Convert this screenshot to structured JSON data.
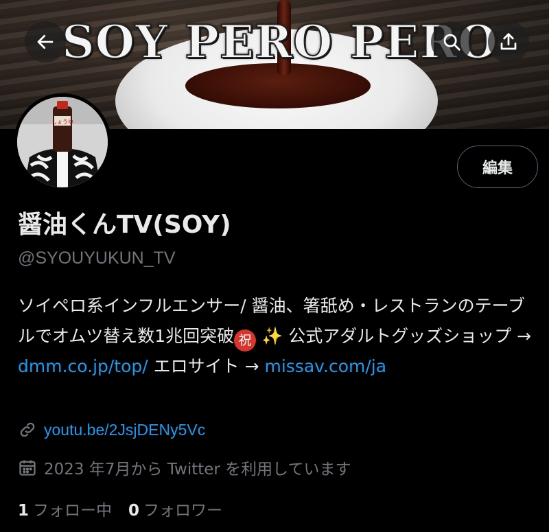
{
  "banner": {
    "title": "SOY PERO PERO"
  },
  "header_buttons": {
    "back": "back-arrow-icon",
    "search": "search-icon",
    "share": "share-icon"
  },
  "profile": {
    "edit_label": "編集",
    "display_name": "醤油くんTV(SOY)",
    "handle": "@SYOUYUKUN_TV",
    "bio": {
      "text1": "ソイペロ系インフルエンサー/ 醤油、箸舐め・レストランのテーブルでオムツ替え数1兆回突破",
      "emoji_iwai": "祝",
      "emoji_sparkle": "✨",
      "text2": " 公式アダルトグッズショップ → ",
      "link1": "dmm.co.jp/top/",
      "text3": " エロサイト → ",
      "link2": "missav.com/ja"
    },
    "website": "youtu.be/2JsjDENy5Vc",
    "joined": "2023 年7月から Twitter を利用しています",
    "following_count": "1",
    "following_label": "フォロー中",
    "followers_count": "0",
    "followers_label": "フォロワー"
  },
  "colors": {
    "background": "#000000",
    "link": "#1d9bf0",
    "muted": "#71767b",
    "text": "#e7e9ea"
  }
}
